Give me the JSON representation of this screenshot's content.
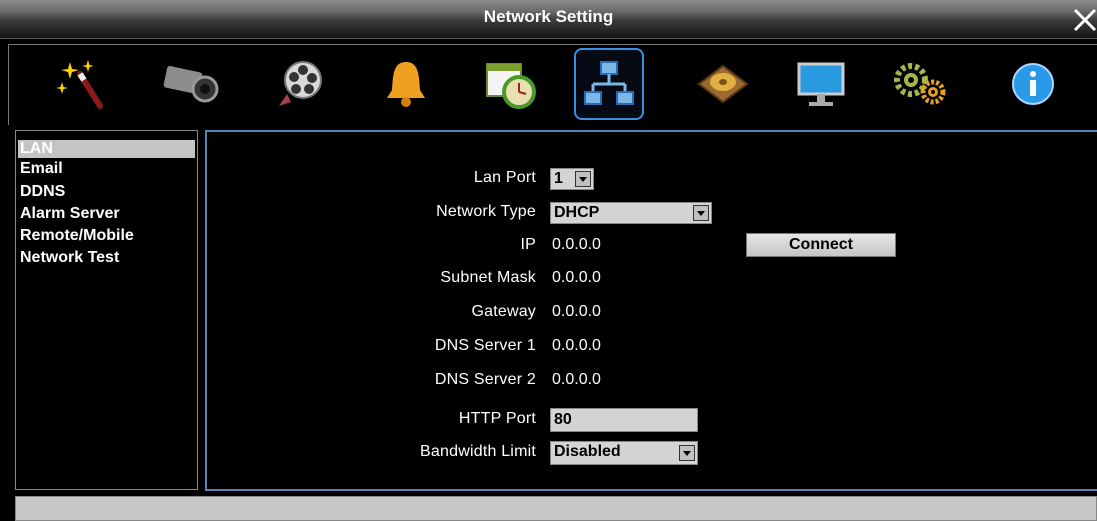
{
  "window": {
    "title": "Network Setting"
  },
  "toolbar": {
    "icons": [
      "magic-wand-icon",
      "camera-icon",
      "film-reel-icon",
      "alarm-bell-icon",
      "schedule-clock-icon",
      "network-icon",
      "hard-disk-icon",
      "monitor-icon",
      "gears-icon",
      "info-icon"
    ],
    "active": "network-icon"
  },
  "sidebar": {
    "items": [
      {
        "label": "LAN",
        "selected": true
      },
      {
        "label": "Email"
      },
      {
        "label": "DDNS"
      },
      {
        "label": "Alarm Server"
      },
      {
        "label": "Remote/Mobile"
      },
      {
        "label": "Network Test"
      }
    ]
  },
  "lan": {
    "lan_port_label": "Lan Port",
    "lan_port_value": "1",
    "network_type_label": "Network Type",
    "network_type_value": "DHCP",
    "ip_label": "IP",
    "ip_value": "0.0.0.0",
    "subnet_label": "Subnet Mask",
    "subnet_value": "0.0.0.0",
    "gateway_label": "Gateway",
    "gateway_value": "0.0.0.0",
    "dns1_label": "DNS Server 1",
    "dns1_value": "0.0.0.0",
    "dns2_label": "DNS Server 2",
    "dns2_value": "0.0.0.0",
    "http_port_label": "HTTP Port",
    "http_port_value": "80",
    "bandwidth_label": "Bandwidth Limit",
    "bandwidth_value": "Disabled",
    "connect_label": "Connect"
  },
  "colors": {
    "accent_border": "#5b7fb8",
    "active_tool_border": "#3a8fe0",
    "selected_item_bg": "#c4c4c4"
  }
}
